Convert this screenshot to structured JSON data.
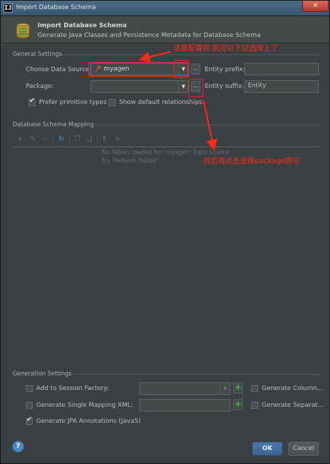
{
  "window": {
    "title": "Import Database Schema",
    "app_icon_text": "IJ",
    "close_label": "✕"
  },
  "header": {
    "title": "Import Database Schema",
    "subtitle": "Generate Java Classes and Persistence Metadata for Database Schema"
  },
  "general_settings": {
    "section_label": "General Settings",
    "choose_data_source_label": "Choose Data Source:",
    "data_source_value": "myagen",
    "package_label": "Package:",
    "package_value": "",
    "entity_prefix_label": "Entity prefix:",
    "entity_prefix_value": "",
    "entity_suffix_label": "Entity suffix:",
    "entity_suffix_value": "Entity",
    "prefer_primitive_types": {
      "label": "Prefer primitive types",
      "checked": true
    },
    "show_default_relationships": {
      "label": "Show default relationships",
      "checked": false
    },
    "dots_label": "..."
  },
  "mapping": {
    "section_label": "Database Schema Mapping",
    "empty_line1": "No Tables loaded for 'myagen' Data Source",
    "empty_line2": "Try 'Refresh Tables'."
  },
  "generation_settings": {
    "section_label": "Generation Settings",
    "add_to_session_factory": {
      "label": "Add to Session Factory:",
      "checked": false
    },
    "generate_single_mapping_xml": {
      "label": "Generate Single Mapping XML:",
      "checked": false
    },
    "generate_jpa_annotations": {
      "label": "Generate JPA Annotations (Java5)",
      "checked": true
    },
    "generate_column_label": "Generate Column...",
    "generate_separate_label": "Generate Separat..."
  },
  "annotations": {
    "note1": "这里配置完  就可以下拉选择上了",
    "note2": "然后再点击选择package即可"
  },
  "footer": {
    "ok_label": "OK",
    "cancel_label": "Cancel",
    "help_label": "?"
  },
  "colors": {
    "background": "#3c3f41",
    "annotation_red": "#ff2a1a",
    "ok_blue": "#4e78a8"
  }
}
